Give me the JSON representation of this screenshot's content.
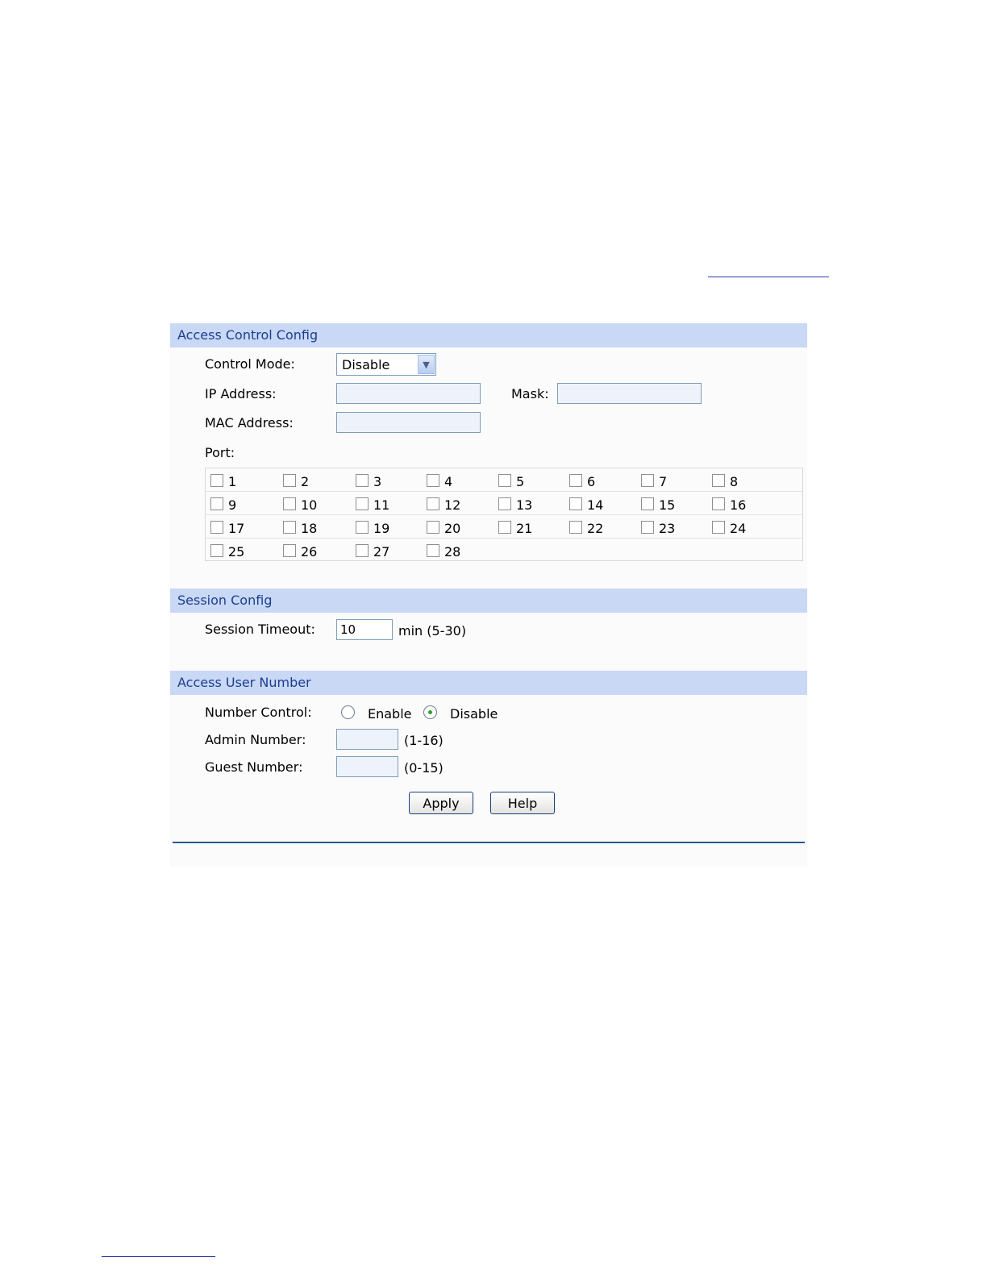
{
  "access_control": {
    "title": "Access Control Config",
    "control_mode": {
      "label": "Control Mode:",
      "value": "Disable"
    },
    "ip_address": {
      "label": "IP Address:",
      "value": ""
    },
    "mask": {
      "label": "Mask:",
      "value": ""
    },
    "mac_address": {
      "label": "MAC Address:",
      "value": ""
    },
    "port": {
      "label": "Port:",
      "rows": [
        [
          "1",
          "2",
          "3",
          "4",
          "5",
          "6",
          "7",
          "8"
        ],
        [
          "9",
          "10",
          "11",
          "12",
          "13",
          "14",
          "15",
          "16"
        ],
        [
          "17",
          "18",
          "19",
          "20",
          "21",
          "22",
          "23",
          "24"
        ],
        [
          "25",
          "26",
          "27",
          "28"
        ]
      ]
    }
  },
  "session": {
    "title": "Session Config",
    "timeout": {
      "label": "Session Timeout:",
      "value": "10",
      "hint": "min (5-30)"
    }
  },
  "access_user": {
    "title": "Access User Number",
    "number_control": {
      "label": "Number Control:",
      "enable": "Enable",
      "disable": "Disable",
      "selected": "Disable"
    },
    "admin_number": {
      "label": "Admin Number:",
      "value": "",
      "hint": "(1-16)"
    },
    "guest_number": {
      "label": "Guest Number:",
      "value": "",
      "hint": "(0-15)"
    }
  },
  "buttons": {
    "apply": "Apply",
    "help": "Help"
  },
  "colors": {
    "section_header_bg": "#c8d8f5",
    "section_header_text": "#1d3e8e",
    "field_bg": "#eef3fb",
    "radio_dot": "#2ea02e"
  }
}
